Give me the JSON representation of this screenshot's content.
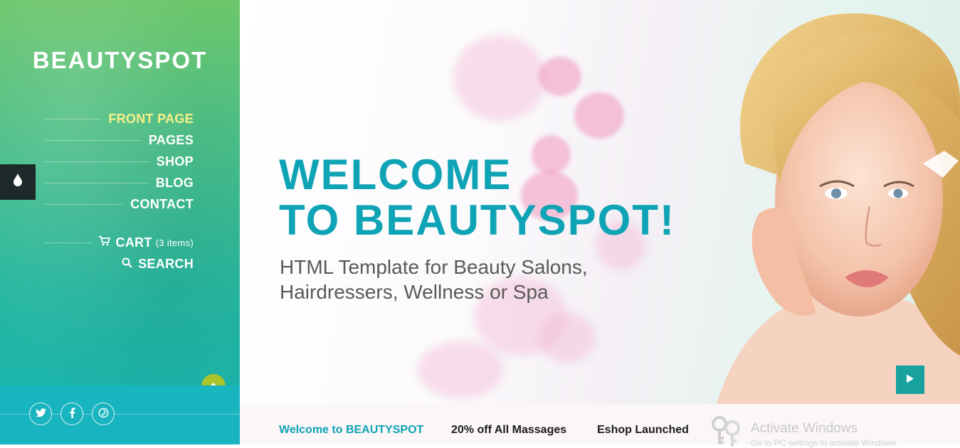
{
  "brand": {
    "logo": "BEAUTYSPOT"
  },
  "nav": {
    "items": [
      {
        "label": "FRONT PAGE",
        "active": true
      },
      {
        "label": "PAGES",
        "active": false
      },
      {
        "label": "SHOP",
        "active": false
      },
      {
        "label": "BLOG",
        "active": false
      },
      {
        "label": "CONTACT",
        "active": false
      }
    ],
    "cart": {
      "icon": "cart-icon",
      "label": "CART",
      "count_text": "(3 items)"
    },
    "search": {
      "icon": "search-icon",
      "label": "SEARCH"
    }
  },
  "hero": {
    "headline_line1": "WELCOME",
    "headline_line2": "TO BEAUTYSPOT!",
    "subtitle_line1": "HTML Template for Beauty Salons,",
    "subtitle_line2": "Hairdressers, Wellness or Spa"
  },
  "newsbar": {
    "items": [
      {
        "label": "Welcome to BEAUTYSPOT",
        "active": true
      },
      {
        "label": "20% off All Massages",
        "active": false
      },
      {
        "label": "Eshop Launched",
        "active": false
      }
    ]
  },
  "watermark": {
    "title": "Activate Windows",
    "subtitle": "Go to PC settings to activate Windows."
  },
  "social": [
    "twitter-icon",
    "facebook-icon",
    "pinterest-icon"
  ],
  "colors": {
    "accent_teal": "#0fa3b6",
    "active_nav": "#f6f08a",
    "scroll_top": "#a9c32a",
    "play_button": "#17a2a0"
  }
}
